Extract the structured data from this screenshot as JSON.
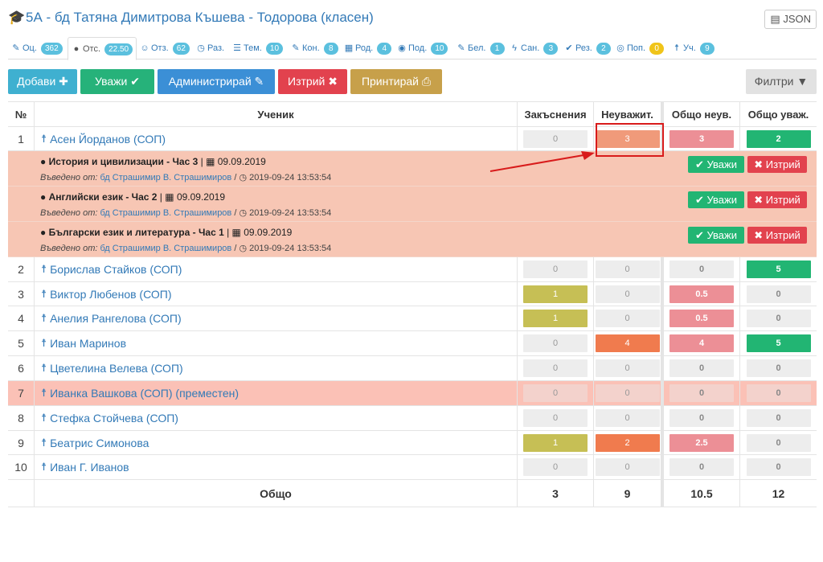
{
  "header": {
    "title": "5А - бд Татяна Димитрова Къшева - Тодорова (класен)",
    "json_label": "JSON"
  },
  "tabs": [
    {
      "label": "Оц.",
      "count": "362",
      "icon": "pencil-icon"
    },
    {
      "label": "Отс.",
      "count": "22.50",
      "icon": "exclamation-circle-icon",
      "active": true
    },
    {
      "label": "Отз.",
      "count": "62",
      "icon": "users-icon"
    },
    {
      "label": "Раз.",
      "count": "",
      "icon": "clock-icon"
    },
    {
      "label": "Тем.",
      "count": "10",
      "icon": "list-icon"
    },
    {
      "label": "Кон.",
      "count": "8",
      "icon": "edit-icon"
    },
    {
      "label": "Род.",
      "count": "4",
      "icon": "calendar-icon"
    },
    {
      "label": "Под.",
      "count": "10",
      "icon": "eye-icon"
    },
    {
      "label": "Бел.",
      "count": "1",
      "icon": "edit-icon"
    },
    {
      "label": "Сан.",
      "count": "3",
      "icon": "bolt-icon"
    },
    {
      "label": "Рез.",
      "count": "2",
      "icon": "check-circle-icon"
    },
    {
      "label": "Поп.",
      "count": "0",
      "icon": "life-ring-icon"
    },
    {
      "label": "Уч.",
      "count": "9",
      "icon": "person-icon"
    }
  ],
  "toolbar": {
    "add": "Добави ✚",
    "excuse": "Уважи ✔",
    "admin": "Администрирай ✎",
    "delete": "Изтрий ✖",
    "print": "Принтирай ⎙",
    "filters": "Филтри ▼"
  },
  "table": {
    "headers": {
      "no": "№",
      "student": "Ученик",
      "excused": "Закъснения",
      "unexcused": "Неуважит.",
      "total_unexcused": "Общо неув.",
      "total_excused": "Общо уваж."
    },
    "rows": [
      {
        "no": "1",
        "name": "Асен Йорданов (СОП)",
        "excused": "0",
        "unexcused": "3",
        "total_unexcused": "3",
        "total_excused": "2"
      },
      {
        "no": "2",
        "name": "Борислав Стайков (СОП)",
        "excused": "0",
        "unexcused": "0",
        "total_unexcused": "0",
        "total_excused": "5"
      },
      {
        "no": "3",
        "name": "Виктор Любенов (СОП)",
        "excused": "1",
        "unexcused": "0",
        "total_unexcused": "0.5",
        "total_excused": "0"
      },
      {
        "no": "4",
        "name": "Анелия Рангелова (СОП)",
        "excused": "1",
        "unexcused": "0",
        "total_unexcused": "0.5",
        "total_excused": "0"
      },
      {
        "no": "5",
        "name": "Иван Маринов",
        "excused": "0",
        "unexcused": "4",
        "total_unexcused": "4",
        "total_excused": "5"
      },
      {
        "no": "6",
        "name": "Цветелина Велева (СОП)",
        "excused": "0",
        "unexcused": "0",
        "total_unexcused": "0",
        "total_excused": "0"
      },
      {
        "no": "7",
        "name": "Иванка Вашкова (СОП) (преместен)",
        "excused": "0",
        "unexcused": "0",
        "total_unexcused": "0",
        "total_excused": "0"
      },
      {
        "no": "8",
        "name": "Стефка Стойчева (СОП)",
        "excused": "0",
        "unexcused": "0",
        "total_unexcused": "0",
        "total_excused": "0"
      },
      {
        "no": "9",
        "name": "Беатрис Симонова",
        "excused": "1",
        "unexcused": "2",
        "total_unexcused": "2.5",
        "total_excused": "0"
      },
      {
        "no": "10",
        "name": "Иван Г. Иванов",
        "excused": "0",
        "unexcused": "0",
        "total_unexcused": "0",
        "total_excused": "0"
      }
    ],
    "details": [
      {
        "subject": "История и цивилизации - Час 3",
        "date": "09.09.2019",
        "entered_by_label": "Въведено от:",
        "teacher": "бд Страшимир В. Страшимиров",
        "timestamp": "2019-09-24 13:53:54"
      },
      {
        "subject": "Английски език - Час 2",
        "date": "09.09.2019",
        "entered_by_label": "Въведено от:",
        "teacher": "бд Страшимир В. Страшимиров",
        "timestamp": "2019-09-24 13:53:54"
      },
      {
        "subject": "Български език и литература - Час 1",
        "date": "09.09.2019",
        "entered_by_label": "Въведено от:",
        "teacher": "бд Страшимир В. Страшимиров",
        "timestamp": "2019-09-24 13:53:54"
      }
    ],
    "detail_buttons": {
      "excuse": "✔ Уважи",
      "delete": "✖ Изтрий"
    },
    "totals": {
      "label": "Общо",
      "excused": "3",
      "unexcused": "9",
      "total_unexcused": "10.5",
      "total_excused": "12"
    }
  },
  "colors": {
    "accent": "#337ab7",
    "highlight": "#d81b1b"
  }
}
